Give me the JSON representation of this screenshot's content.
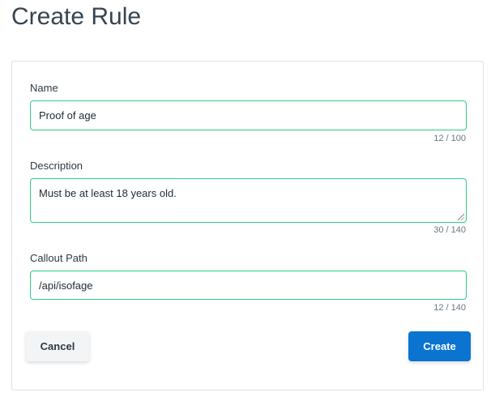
{
  "title": "Create Rule",
  "fields": [
    {
      "label": "Name",
      "value": "Proof of age",
      "counter": "12 / 100"
    },
    {
      "label": "Description",
      "value": "Must be at least 18 years old.",
      "counter": "30 / 140"
    },
    {
      "label": "Callout Path",
      "value": "/api/isofage",
      "counter": "12 / 140"
    }
  ],
  "buttons": {
    "cancel": "Cancel",
    "create": "Create"
  }
}
